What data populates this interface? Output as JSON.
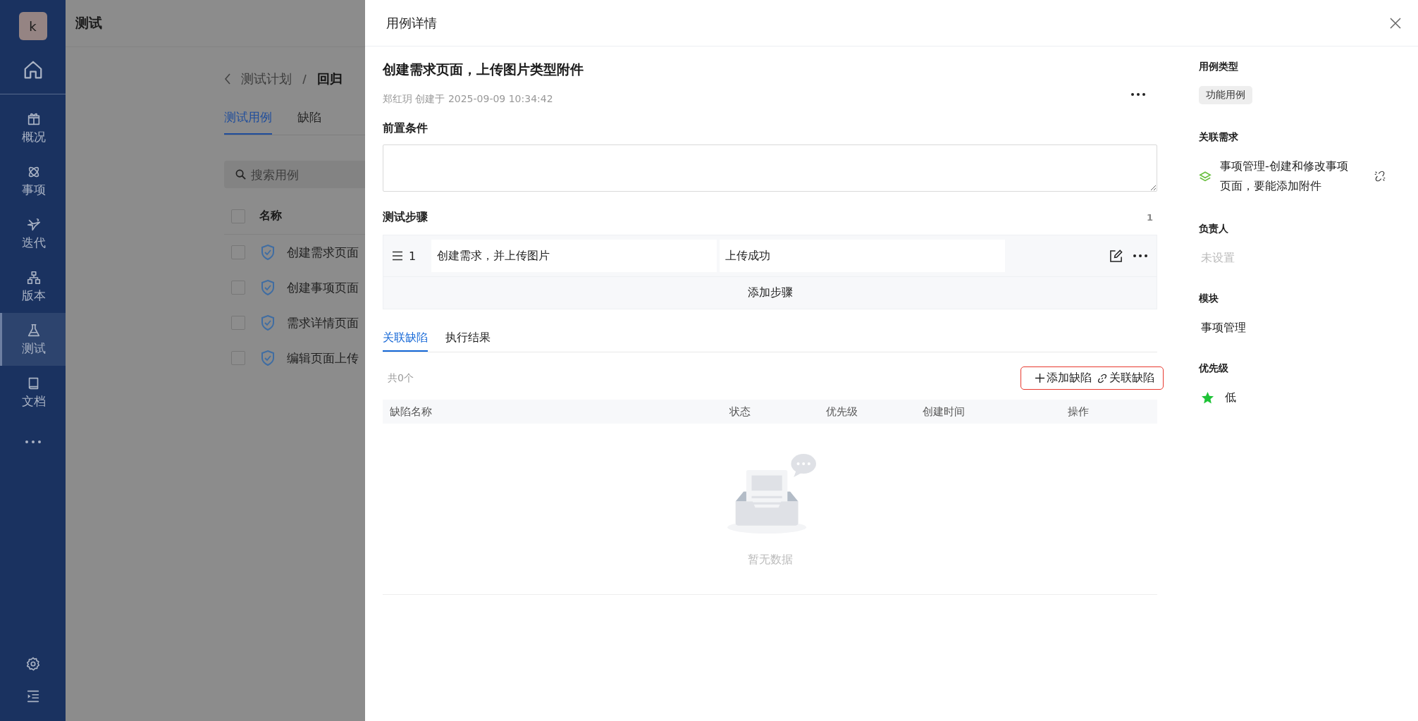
{
  "sidebar": {
    "avatar": "k",
    "items": [
      {
        "label": "概况",
        "selected": false
      },
      {
        "label": "事项",
        "selected": false
      },
      {
        "label": "迭代",
        "selected": false
      },
      {
        "label": "版本",
        "selected": false
      },
      {
        "label": "测试",
        "selected": true
      },
      {
        "label": "文档",
        "selected": false
      }
    ]
  },
  "page": {
    "title": "测试",
    "breadcrumb": [
      "测试计划",
      "回归"
    ],
    "tabs": [
      {
        "label": "测试用例",
        "selected": true
      },
      {
        "label": "缺陷",
        "selected": false
      }
    ],
    "search": {
      "placeholder": "搜索用例"
    },
    "table": {
      "column": "名称",
      "all_checked": false,
      "rows": [
        {
          "name": "创建需求页面",
          "checked": false
        },
        {
          "name": "创建事项页面",
          "checked": false
        },
        {
          "name": "需求详情页面",
          "checked": false
        },
        {
          "name": "编辑页面上传",
          "checked": false
        }
      ]
    }
  },
  "drawer": {
    "title": "用例详情",
    "case": {
      "title": "创建需求页面，上传图片类型附件",
      "meta": "郑红玥 创建于 2025-09-09 10:34:42"
    },
    "precondition": {
      "label": "前置条件"
    },
    "steps": {
      "label": "测试步骤",
      "count": "1",
      "add_label": "添加步骤",
      "rows": [
        {
          "number": "1",
          "action": "创建需求，并上传图片",
          "expected": "上传成功"
        }
      ]
    },
    "tabs": [
      {
        "label": "关联缺陷",
        "selected": true
      },
      {
        "label": "执行结果",
        "selected": false
      }
    ],
    "defects": {
      "total": "共0个",
      "actions": [
        {
          "kind": "add",
          "label": "添加缺陷"
        },
        {
          "kind": "link",
          "label": "关联缺陷"
        }
      ],
      "columns": [
        "缺陷名称",
        "状态",
        "优先级",
        "创建时间",
        "操作"
      ],
      "empty_text": "暂无数据"
    },
    "details": [
      {
        "kind": "tag",
        "label": "用例类型",
        "value": "功能用例"
      },
      {
        "kind": "requirement",
        "label": "关联需求",
        "value": "事项管理-创建和修改事项页面，要能添加附件"
      },
      {
        "kind": "unset",
        "label": "负责人",
        "value": "未设置"
      },
      {
        "kind": "text",
        "label": "模块",
        "value": "事项管理"
      },
      {
        "kind": "priority",
        "label": "优先级",
        "value": "低",
        "color": "#1ec337"
      }
    ]
  }
}
